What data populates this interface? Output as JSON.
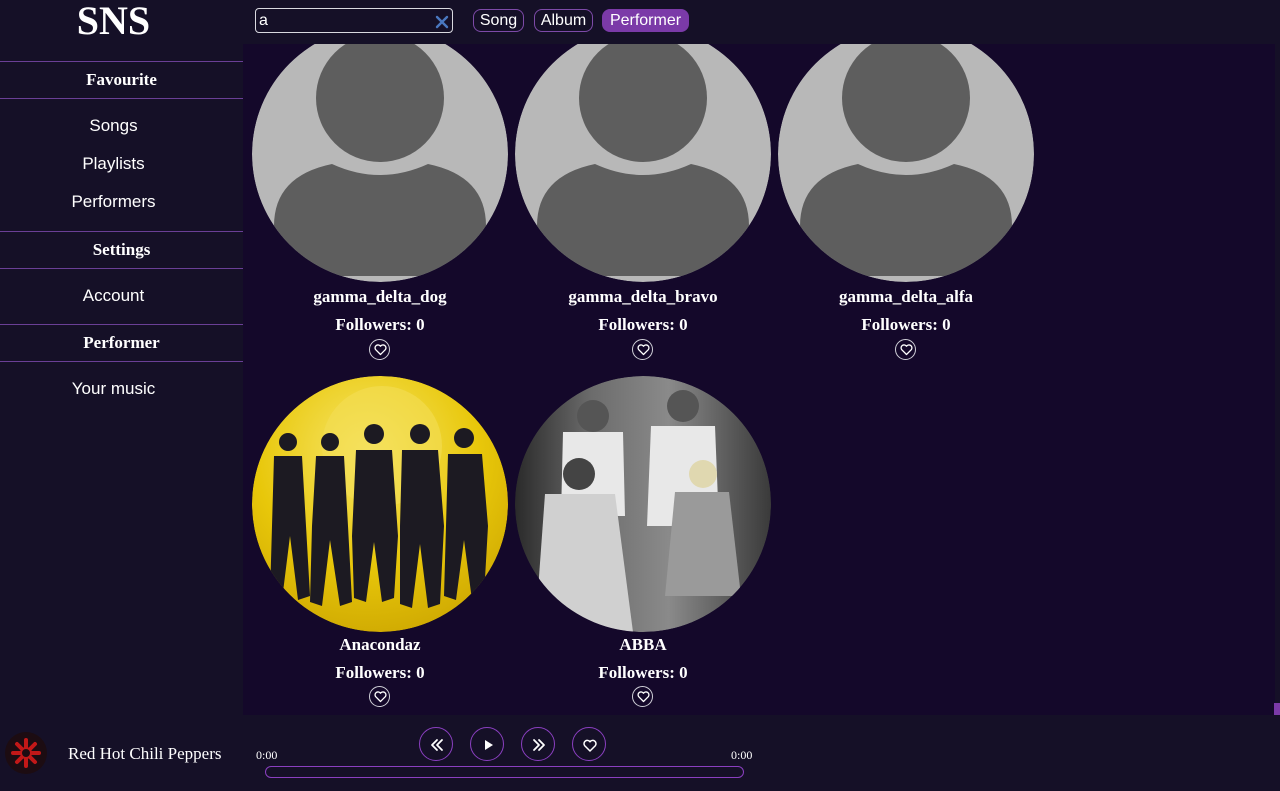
{
  "app": {
    "logo": "SNS"
  },
  "sidebar": {
    "sections": [
      {
        "heading": "Favourite",
        "items": [
          "Songs",
          "Playlists",
          "Performers"
        ]
      },
      {
        "heading": "Settings",
        "items": [
          "Account"
        ]
      },
      {
        "heading": "Performer",
        "items": [
          "Your music"
        ]
      }
    ]
  },
  "search": {
    "value": "a",
    "placeholder": ""
  },
  "filters": [
    {
      "label": "Song",
      "active": false
    },
    {
      "label": "Album",
      "active": false
    },
    {
      "label": "Performer",
      "active": true
    }
  ],
  "performers": [
    {
      "name": "gamma_delta_dog",
      "followers": "Followers: 0",
      "avatar": "default-avatar-icon"
    },
    {
      "name": "gamma_delta_bravo",
      "followers": "Followers: 0",
      "avatar": "default-avatar-icon"
    },
    {
      "name": "gamma_delta_alfa",
      "followers": "Followers: 0",
      "avatar": "default-avatar-icon"
    },
    {
      "name": "Anacondaz",
      "followers": "Followers: 0",
      "avatar": "band-photo-yellow"
    },
    {
      "name": "ABBA",
      "followers": "Followers: 0",
      "avatar": "band-photo-bw"
    }
  ],
  "player": {
    "track_title": "Red Hot Chili Peppers",
    "time_current": "0:00",
    "time_total": "0:00",
    "progress": 0
  },
  "colors": {
    "background": "#151027",
    "main_background": "#14082a",
    "accent": "#7b3aa8",
    "divider": "#6a3f96"
  }
}
